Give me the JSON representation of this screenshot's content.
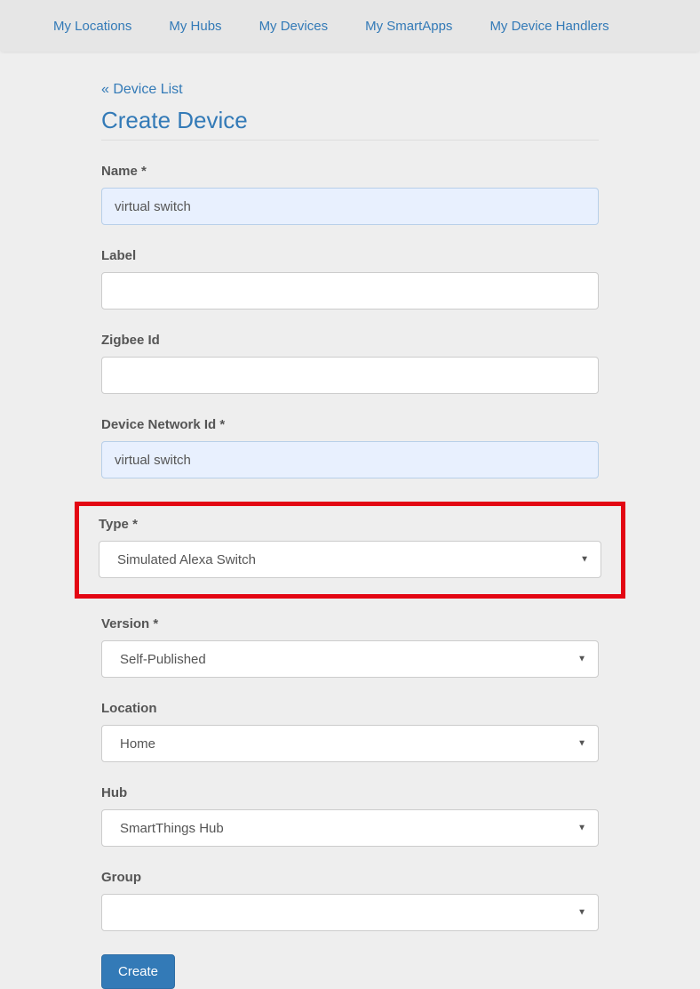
{
  "nav": {
    "items": [
      "My Locations",
      "My Hubs",
      "My Devices",
      "My SmartApps",
      "My Device Handlers"
    ]
  },
  "back_link": "« Device List",
  "page_title": "Create Device",
  "form": {
    "name": {
      "label": "Name *",
      "value": "virtual switch"
    },
    "label": {
      "label": "Label",
      "value": ""
    },
    "zigbee_id": {
      "label": "Zigbee Id",
      "value": ""
    },
    "device_network_id": {
      "label": "Device Network Id *",
      "value": "virtual switch"
    },
    "type": {
      "label": "Type *",
      "value": "Simulated Alexa Switch"
    },
    "version": {
      "label": "Version *",
      "value": "Self-Published"
    },
    "location": {
      "label": "Location",
      "value": "Home"
    },
    "hub": {
      "label": "Hub",
      "value": "SmartThings Hub"
    },
    "group": {
      "label": "Group",
      "value": ""
    }
  },
  "buttons": {
    "create": "Create"
  }
}
